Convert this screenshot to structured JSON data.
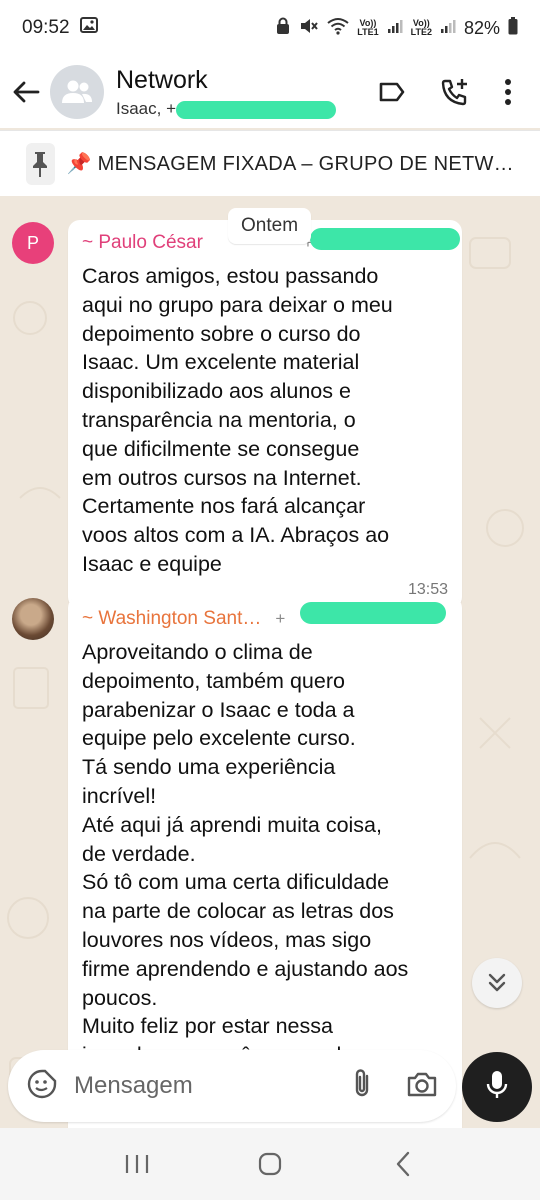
{
  "status_bar": {
    "time": "09:52",
    "battery": "82%",
    "sim1_label_top": "Vo))",
    "sim1_label_bottom": "LTE1",
    "sim2_label_top": "Vo))",
    "sim2_label_bottom": "LTE2",
    "icons": [
      "image-icon",
      "lock-icon",
      "mute-icon",
      "wifi-icon",
      "signal-icon",
      "battery-icon"
    ]
  },
  "header": {
    "title": "Network",
    "subtitle": "Isaac, +",
    "icons": [
      "back-arrow-icon",
      "group-avatar-icon",
      "label-icon",
      "add-call-icon",
      "more-vert-icon"
    ]
  },
  "pinned": {
    "text": "📌 MENSAGEM FIXADA – GRUPO DE NETW…",
    "icon": "pin-icon"
  },
  "chat": {
    "date_chip": "Ontem",
    "messages": [
      {
        "avatar_letter": "P",
        "avatar_color": "#e8407a",
        "sender": "~ Paulo César",
        "sender_color": "#e0407a",
        "phone": "+",
        "text": "Caros amigos, estou passando\naqui no grupo para deixar o meu\ndepoimento sobre o curso do\nIsaac. Um excelente material\ndisponibilizado aos alunos e\ntransparência na mentoria, o\nque dificilmente se consegue\nem outros cursos na Internet.\nCertamente nos fará alcançar\nvoos altos com a IA. Abraços ao\nIsaac e equipe",
        "time": "13:53"
      },
      {
        "sender": "~ Washington Sant…",
        "sender_color": "#e8743c",
        "phone": "+",
        "text": "Aproveitando o clima de\ndepoimento, também quero\nparabenizar o Isaac e toda a\nequipe pelo excelente curso.\nTá sendo uma experiência\nincrível!\nAté aqui já aprendi muita coisa,\nde verdade.\nSó tô com uma certa dificuldade\nna parte de colocar as letras dos\nlouvores nos vídeos, mas sigo\nfirme aprendendo e ajustando aos\npoucos.\nMuito feliz por estar nessa\njornada com vocês e grande que"
      }
    ],
    "redaction_color": "#3de6a8"
  },
  "composer": {
    "placeholder": "Mensagem",
    "icons": [
      "emoji-sticker-icon",
      "attach-icon",
      "camera-icon",
      "mic-icon"
    ]
  },
  "nav": {
    "icons": [
      "recents-icon",
      "home-icon",
      "back-icon"
    ]
  }
}
